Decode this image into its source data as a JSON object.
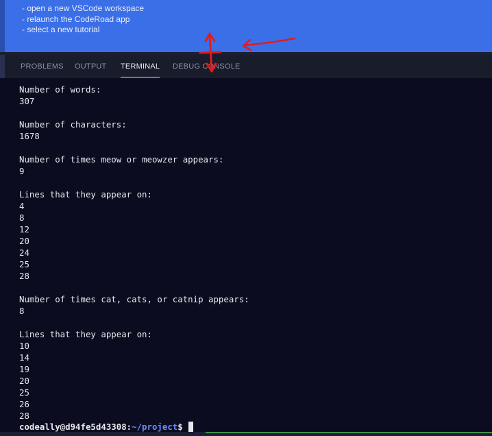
{
  "banner": {
    "items": [
      "- open a new VSCode workspace",
      "- relaunch the CodeRoad app",
      "- select a new tutorial"
    ]
  },
  "panel": {
    "tabs": [
      {
        "label": "PROBLEMS",
        "active": false
      },
      {
        "label": "OUTPUT",
        "active": false
      },
      {
        "label": "TERMINAL",
        "active": true
      },
      {
        "label": "DEBUG CONSOLE",
        "active": false
      }
    ]
  },
  "terminal": {
    "lines": [
      "Number of words:",
      "307",
      "",
      "Number of characters:",
      "1678",
      "",
      "Number of times meow or meowzer appears:",
      "9",
      "",
      "Lines that they appear on:",
      "4",
      "8",
      "12",
      "20",
      "24",
      "25",
      "28",
      "",
      "Number of times cat, cats, or catnip appears:",
      "8",
      "",
      "Lines that they appear on:",
      "10",
      "14",
      "19",
      "20",
      "25",
      "26",
      "28"
    ],
    "prompt": {
      "user_host": "codeally@d94fe5d43308",
      "separator": ":",
      "path": "~/project",
      "symbol": "$"
    }
  },
  "colors": {
    "banner": "#3b6fe8",
    "terminal_bg": "#0b0c1f",
    "annotation_red": "#e31b1b"
  },
  "annotations": [
    "resize-arrow-icon",
    "pointer-arrow-icon"
  ]
}
